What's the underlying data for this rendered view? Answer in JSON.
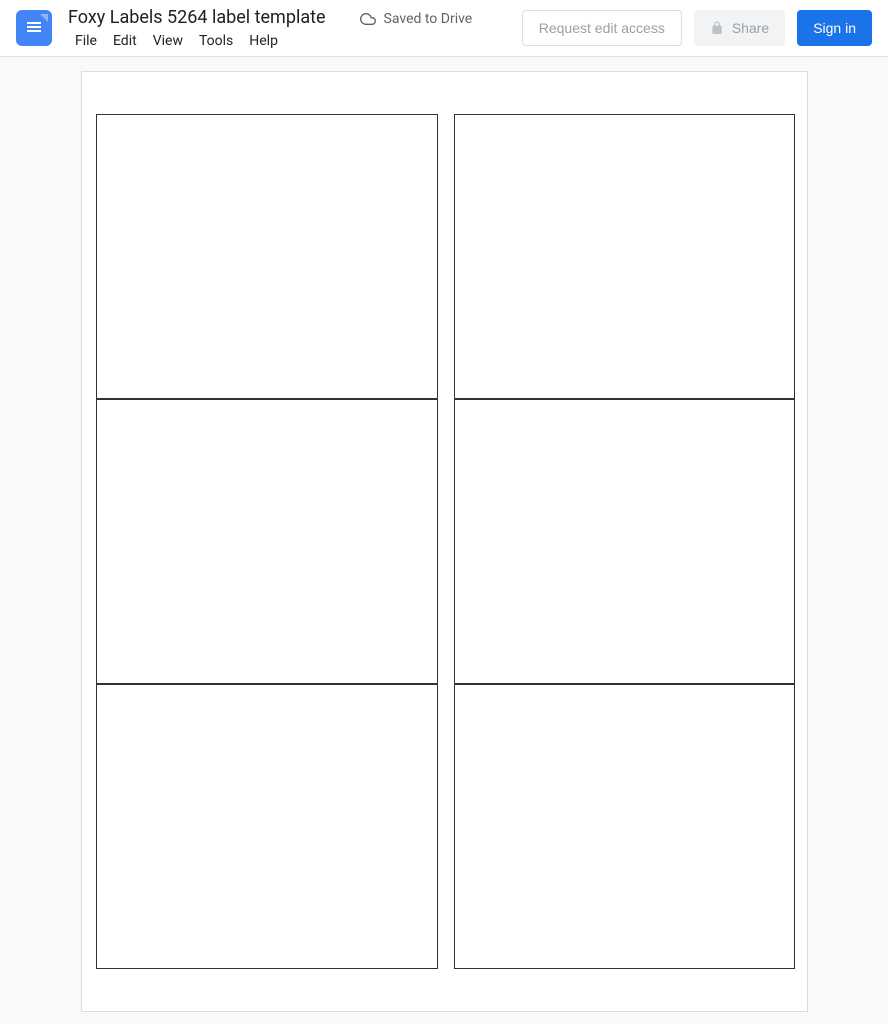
{
  "header": {
    "doc_title": "Foxy Labels 5264 label template",
    "save_status": "Saved to Drive",
    "menus": [
      "File",
      "Edit",
      "View",
      "Tools",
      "Help"
    ],
    "buttons": {
      "request_access": "Request edit access",
      "share": "Share",
      "signin": "Sign in"
    }
  },
  "document": {
    "labels": [
      "",
      "",
      "",
      "",
      "",
      ""
    ]
  }
}
